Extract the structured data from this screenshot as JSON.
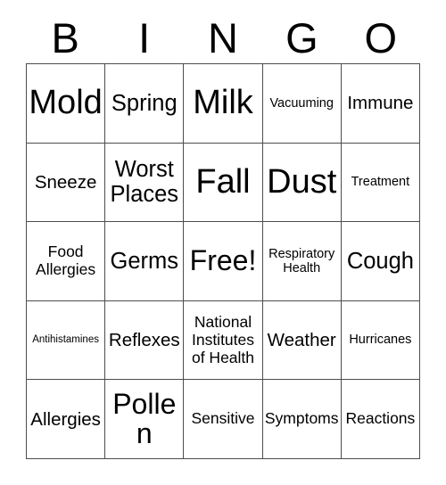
{
  "card": {
    "title": "Bingo Card",
    "header_letters": [
      "B",
      "I",
      "N",
      "G",
      "O"
    ],
    "grid": {
      "rows": 5,
      "columns": 5,
      "border_color": "#4d4d4d",
      "background_color": "#ffffff",
      "text_color": "#000000"
    },
    "cells": [
      [
        {
          "text": "Mold",
          "size": "huge"
        },
        {
          "text": "Spring",
          "size": "xl"
        },
        {
          "text": "Milk",
          "size": "huge"
        },
        {
          "text": "Vacuuming",
          "size": "sm"
        },
        {
          "text": "Immune",
          "size": "lg"
        }
      ],
      [
        {
          "text": "Sneeze",
          "size": "lg"
        },
        {
          "text": "Worst Places",
          "size": "xl"
        },
        {
          "text": "Fall",
          "size": "huge"
        },
        {
          "text": "Dust",
          "size": "huge"
        },
        {
          "text": "Treatment",
          "size": "sm"
        }
      ],
      [
        {
          "text": "Food Allergies",
          "size": "md"
        },
        {
          "text": "Germs",
          "size": "xl"
        },
        {
          "text": "Free!",
          "size": "xxl"
        },
        {
          "text": "Respiratory Health",
          "size": "sm"
        },
        {
          "text": "Cough",
          "size": "xl"
        }
      ],
      [
        {
          "text": "Antihistamines",
          "size": "xs"
        },
        {
          "text": "Reflexes",
          "size": "lg"
        },
        {
          "text": "National Institutes of Health",
          "size": "md"
        },
        {
          "text": "Weather",
          "size": "lg"
        },
        {
          "text": "Hurricanes",
          "size": "sm"
        }
      ],
      [
        {
          "text": "Allergies",
          "size": "lg"
        },
        {
          "text": "Pollen",
          "size": "xxl"
        },
        {
          "text": "Sensitive",
          "size": "md"
        },
        {
          "text": "Symptoms",
          "size": "md"
        },
        {
          "text": "Reactions",
          "size": "md"
        }
      ]
    ],
    "free_space": {
      "row": 2,
      "column": 2,
      "label": "Free!"
    }
  }
}
